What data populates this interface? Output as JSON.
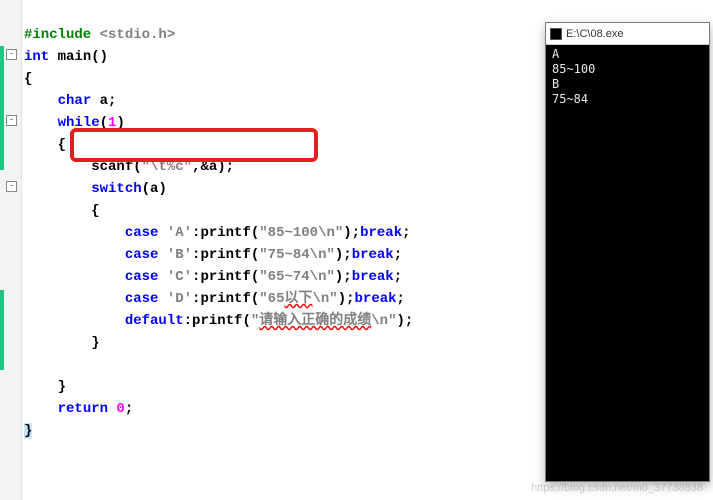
{
  "code": {
    "l1_include": "#include",
    "l1_hdr": " <stdio.h>",
    "l2_int": "int",
    "l2_main": " main",
    "l2_pars": "()",
    "l3_brace": "{",
    "l4_char": "char",
    "l4_a": " a;",
    "l5_while": "while",
    "l5_paren_o": "(",
    "l5_one": "1",
    "l5_paren_c": ")",
    "l6_brace": "{",
    "l7_scanf": "scanf(",
    "l7_fmt": "\"\\t%c\"",
    "l7_rest": ",&a);",
    "l8_switch": "switch",
    "l8_arg": "(a)",
    "l9_brace": "{",
    "case_kw": "case",
    "break_kw": "break",
    "default_kw": "default",
    "caseA_ch": " 'A'",
    "caseA_pr": ":printf(",
    "caseA_str": "\"85~100\\n\"",
    "caseA_end": ");",
    "caseB_ch": " 'B'",
    "caseB_str": "\"75~84\\n\"",
    "caseC_ch": " 'C'",
    "caseC_str": "\"65~74\\n\"",
    "caseD_ch": " 'D'",
    "caseD_pre": "\"65",
    "caseD_cjk": "以下",
    "caseD_post": "\\n\"",
    "default_pr": ":printf(",
    "default_pre": "\"",
    "default_cjk": "请输入正确的成绩",
    "default_post": "\\n\"",
    "default_end": ");",
    "semi": ";",
    "close_brace": "}",
    "return_kw": "return",
    "return_val": " 0",
    "return_semi": ";"
  },
  "console": {
    "title": "E:\\C\\08.exe",
    "lines": "A\n85~100\nB\n75~84"
  },
  "watermark": "https://blog.csdn.net/m0_37738838"
}
